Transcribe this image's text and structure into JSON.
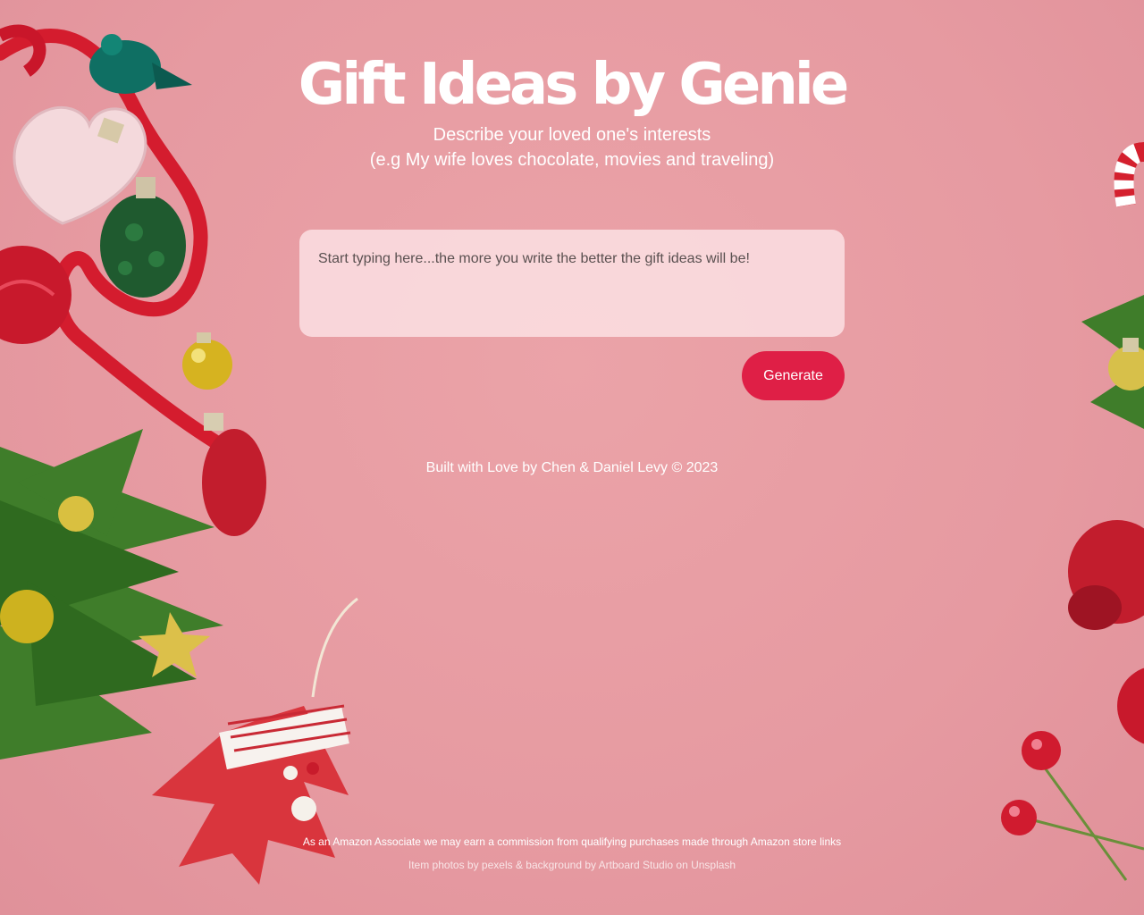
{
  "header": {
    "title": "Gift Ideas by Genie",
    "subtitle_line1": "Describe your loved one's interests",
    "subtitle_line2": "(e.g My wife loves chocolate, movies and traveling)"
  },
  "form": {
    "input_value": "",
    "input_placeholder": "Start typing here...the more you write the better the gift ideas will be!",
    "generate_label": "Generate"
  },
  "footer": {
    "credit": "Built with Love by Chen & Daniel Levy © 2023",
    "disclaimer": "As an Amazon Associate we may earn a commission from qualifying purchases made through Amazon store links",
    "photo_credit": "Item photos by pexels & background by Artboard Studio on Unsplash"
  },
  "colors": {
    "background": "#e69aa1",
    "accent": "#df1f46",
    "text": "#ffffff"
  },
  "decorations": [
    "christmas-ornaments-left",
    "christmas-ornaments-right"
  ]
}
